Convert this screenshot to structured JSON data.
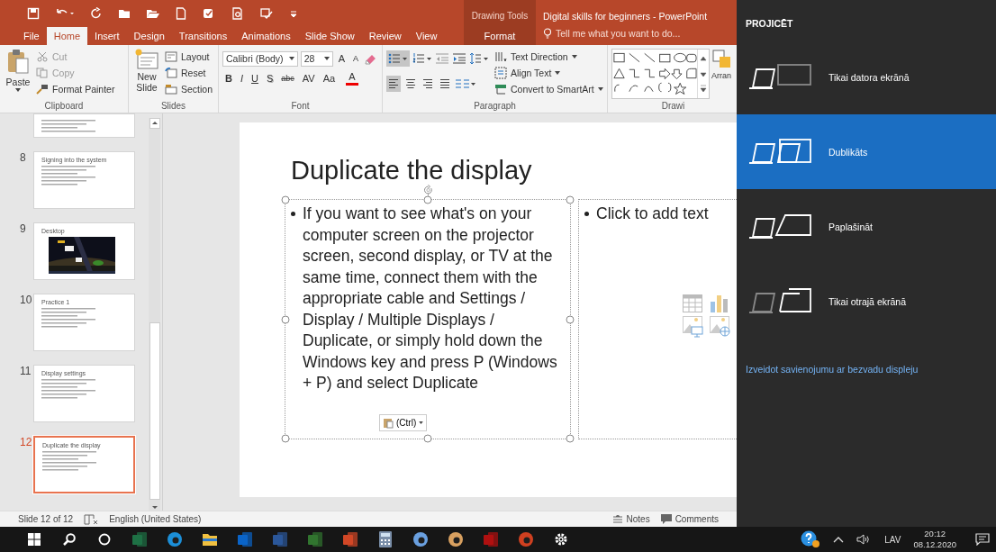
{
  "title_bar": {
    "contextual_label": "Drawing Tools",
    "title": "Digital skills for beginners - PowerPoint"
  },
  "tabs": [
    {
      "label": "File",
      "selected": false,
      "kind": "normal"
    },
    {
      "label": "Home",
      "selected": true,
      "kind": "normal"
    },
    {
      "label": "Insert",
      "selected": false,
      "kind": "normal"
    },
    {
      "label": "Design",
      "selected": false,
      "kind": "normal"
    },
    {
      "label": "Transitions",
      "selected": false,
      "kind": "normal"
    },
    {
      "label": "Animations",
      "selected": false,
      "kind": "normal"
    },
    {
      "label": "Slide Show",
      "selected": false,
      "kind": "normal"
    },
    {
      "label": "Review",
      "selected": false,
      "kind": "normal"
    },
    {
      "label": "View",
      "selected": false,
      "kind": "normal"
    },
    {
      "label": "Format",
      "selected": false,
      "kind": "contextual"
    }
  ],
  "tell_me": {
    "placeholder": "Tell me what you want to do..."
  },
  "ribbon": {
    "clipboard": {
      "paste": "Paste",
      "items": [
        {
          "label": "Cut",
          "disabled": true
        },
        {
          "label": "Copy",
          "disabled": true
        },
        {
          "label": "Format Painter",
          "disabled": false
        }
      ],
      "label": "Clipboard"
    },
    "slides": {
      "new_slide": "New Slide",
      "items": [
        "Layout",
        "Reset",
        "Section"
      ],
      "label": "Slides"
    },
    "font": {
      "family": "Calibri (Body)",
      "size": "28",
      "size_buttons": [
        "A",
        "A"
      ],
      "format_buttons": [
        "B",
        "I",
        "U",
        "S",
        "abc",
        "AV",
        "Aa"
      ],
      "color_button": "A",
      "label": "Font"
    },
    "paragraph": {
      "bullets_selected": true,
      "alignment": [
        {
          "kind": "left",
          "selected": true
        },
        {
          "kind": "center",
          "selected": false
        },
        {
          "kind": "right",
          "selected": false
        },
        {
          "kind": "justify",
          "selected": false
        }
      ],
      "items": [
        "Text Direction",
        "Align Text",
        "Convert to SmartArt"
      ],
      "label": "Paragraph"
    },
    "drawing": {
      "arrange": "Arran",
      "label": "Drawi"
    }
  },
  "thumbnails": [
    {
      "selected": false,
      "kind": "partial"
    },
    {
      "number": "8",
      "title": "Signing into the system",
      "selected": false,
      "kind": "text"
    },
    {
      "number": "9",
      "title": "Desktop",
      "selected": false,
      "kind": "picture"
    },
    {
      "number": "10",
      "title": "Practice 1",
      "selected": false,
      "kind": "text"
    },
    {
      "number": "11",
      "title": "Display settings",
      "selected": false,
      "kind": "text"
    },
    {
      "number": "12",
      "title": "Duplicate the display",
      "selected": true,
      "kind": "text"
    }
  ],
  "slide": {
    "title": "Duplicate the display",
    "body": "If you want to see what's on your computer screen on the projector screen, second display, or TV at the same time, connect them with the appropriate cable and Settings / Display / Multiple Displays / Duplicate, or simply hold down the Windows key and press P (Windows + P) and select Duplicate",
    "placeholder": "Click to add text",
    "paste_options": "(Ctrl)"
  },
  "status_bar": {
    "slide_info": "Slide 12 of 12",
    "language": "English (United States)",
    "notes": "Notes",
    "comments": "Comments"
  },
  "project_panel": {
    "title": "PROJICĒT",
    "options": [
      {
        "label": "Tikai datora ekrānā",
        "kind": "pc_only",
        "selected": false
      },
      {
        "label": "Dublikāts",
        "kind": "duplicate",
        "selected": true
      },
      {
        "label": "Paplašināt",
        "kind": "extend",
        "selected": false
      },
      {
        "label": "Tikai otrajā ekrānā",
        "kind": "second_only",
        "selected": false
      }
    ],
    "link": "Izveidot savienojumu ar bezvadu displeju"
  },
  "taskbar": {
    "apps": [
      {
        "kind": "start",
        "color": "#ffffff"
      },
      {
        "kind": "search",
        "color": "#ffffff"
      },
      {
        "kind": "cortana",
        "color": "#ffffff"
      },
      {
        "kind": "tile",
        "color": "#1e7145"
      },
      {
        "kind": "round",
        "color": "#1c8fd8"
      },
      {
        "kind": "folder",
        "color": "#f0c040"
      },
      {
        "kind": "tile",
        "color": "#0a64c8"
      },
      {
        "kind": "tile",
        "color": "#2b579a"
      },
      {
        "kind": "tile",
        "color": "#31752f"
      },
      {
        "kind": "tile",
        "color": "#d24726"
      },
      {
        "kind": "calc",
        "color": "#7a8ea8"
      },
      {
        "kind": "round",
        "color": "#6aa0e0"
      },
      {
        "kind": "round",
        "color": "#d8a060"
      },
      {
        "kind": "tile",
        "color": "#b01010"
      },
      {
        "kind": "round",
        "color": "#d04020"
      },
      {
        "kind": "gear",
        "color": "#ffffff"
      }
    ],
    "language": "LAV",
    "time": "20:12",
    "date": "08.12.2020"
  }
}
